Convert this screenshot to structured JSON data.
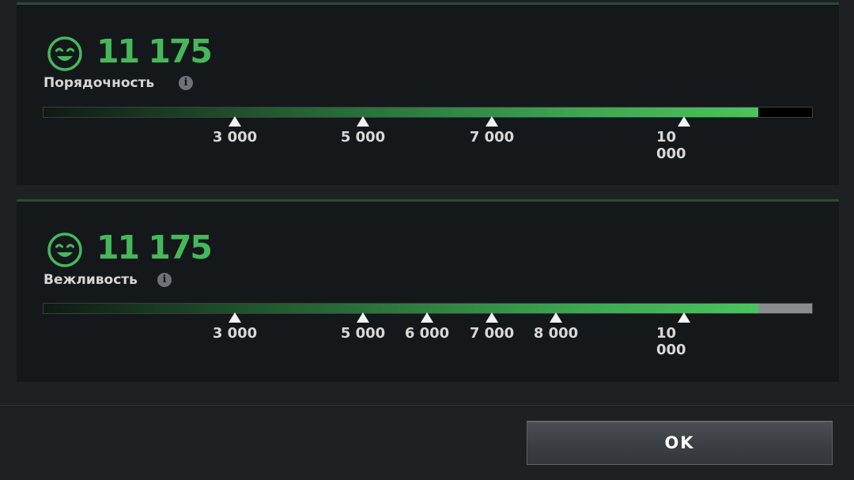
{
  "panels": [
    {
      "score": "11 175",
      "label": "Порядочность",
      "progress": 0.93,
      "track_color": "#000000",
      "markers": [
        {
          "value": 3000,
          "label": "3 000"
        },
        {
          "value": 5000,
          "label": "5 000"
        },
        {
          "value": 7000,
          "label": "7 000"
        },
        {
          "value": 10000,
          "label": "10 000"
        }
      ]
    },
    {
      "score": "11 175",
      "label": "Вежливость",
      "progress": 0.93,
      "track_color": "#8a8d90",
      "markers": [
        {
          "value": 3000,
          "label": "3 000"
        },
        {
          "value": 5000,
          "label": "5 000"
        },
        {
          "value": 6000,
          "label": "6 000"
        },
        {
          "value": 7000,
          "label": "7 000"
        },
        {
          "value": 8000,
          "label": "8 000"
        },
        {
          "value": 10000,
          "label": "10 000"
        }
      ]
    }
  ],
  "ok_button": "OK",
  "colors": {
    "accent_green": "#46b85a",
    "panel_bg": "#15181b",
    "page_bg": "#1e2124"
  },
  "icons": [
    "smiley-face-icon",
    "info-icon",
    "marker-triangle-icon"
  ]
}
